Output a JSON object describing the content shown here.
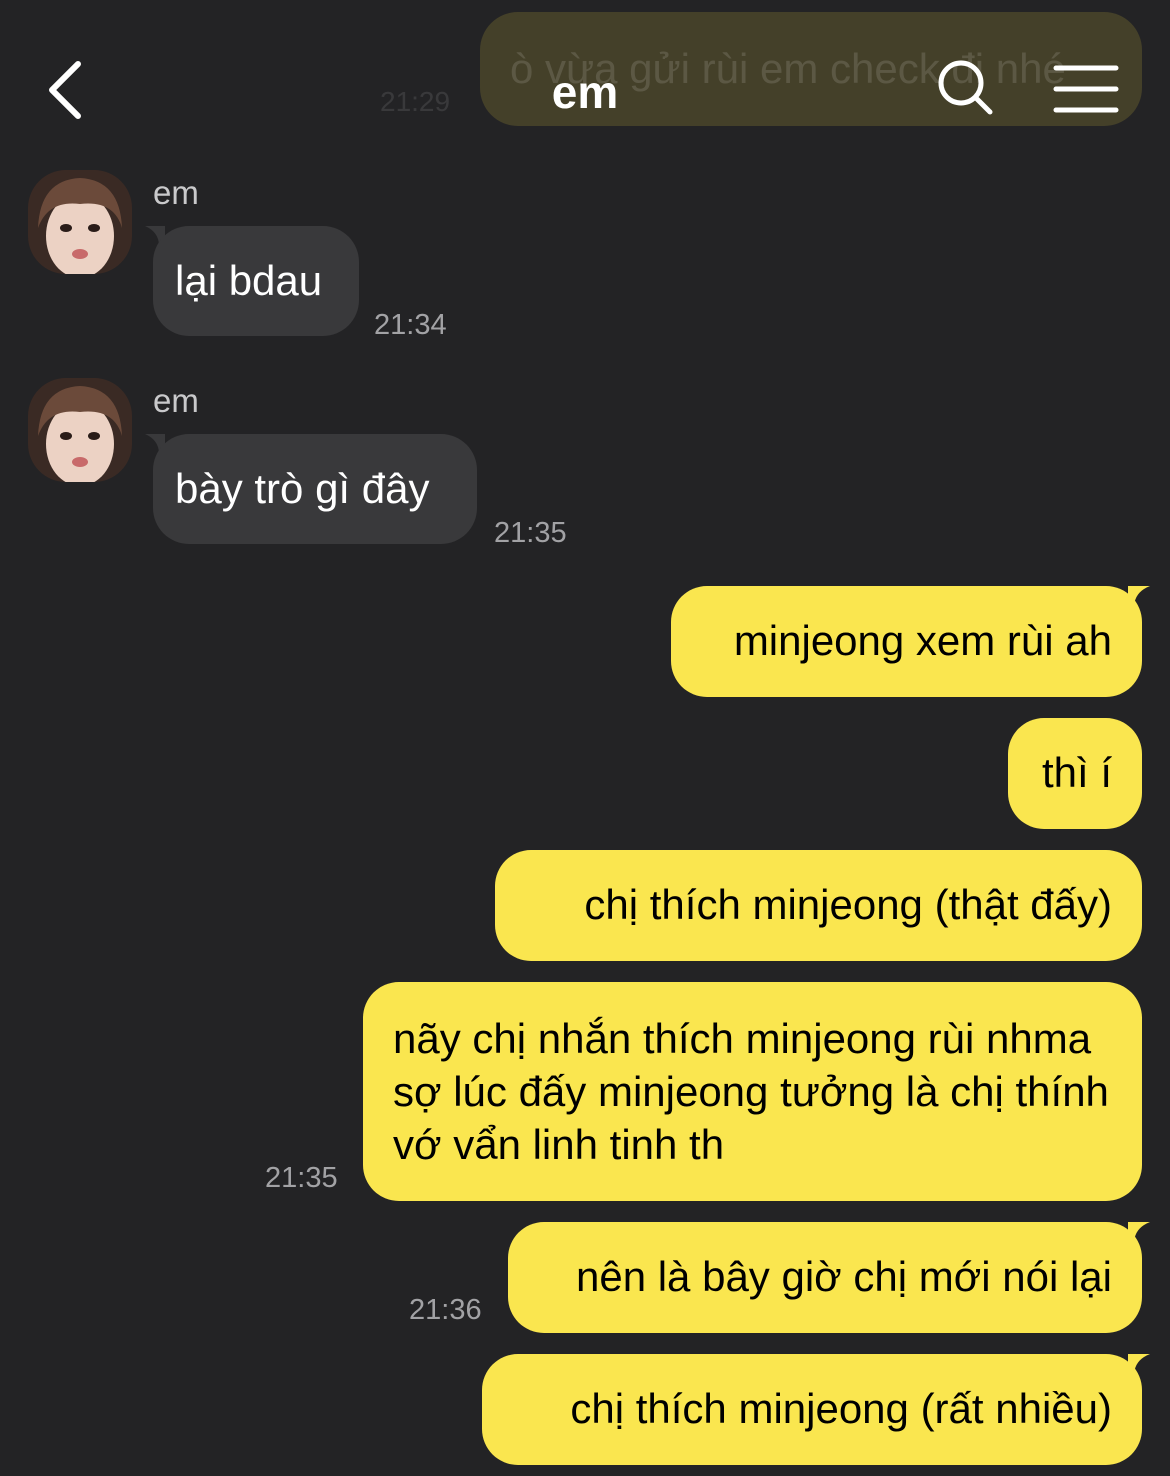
{
  "header": {
    "title": "em",
    "back_icon": "chevron-left-icon",
    "search_icon": "search-icon",
    "menu_icon": "menu-icon"
  },
  "faded_message": {
    "text": "ò vừa gửi rùi em check đi nhé",
    "time": "21:29"
  },
  "received": [
    {
      "sender": "em",
      "text": "lại bdau",
      "time": "21:34"
    },
    {
      "sender": "em",
      "text": "bày trò gì đây",
      "time": "21:35"
    }
  ],
  "sent": [
    {
      "text": "minjeong xem rùi ah",
      "time": ""
    },
    {
      "text": "thì í",
      "time": ""
    },
    {
      "text": "chị thích minjeong (thật đấy)",
      "time": ""
    },
    {
      "text": "nãy chị nhắn thích minjeong rùi nhma sợ lúc đấy minjeong tưởng là chị thính vớ vẩn linh tinh th",
      "time": "21:35"
    },
    {
      "text": "nên là bây giờ chị mới nói lại",
      "time": "21:36"
    },
    {
      "text": "chị thích minjeong (rất nhiều)",
      "time": ""
    }
  ],
  "colors": {
    "background": "#232325",
    "incoming_bubble": "#39393b",
    "outgoing_bubble": "#fae64f",
    "timestamp": "#a2a2a5"
  }
}
